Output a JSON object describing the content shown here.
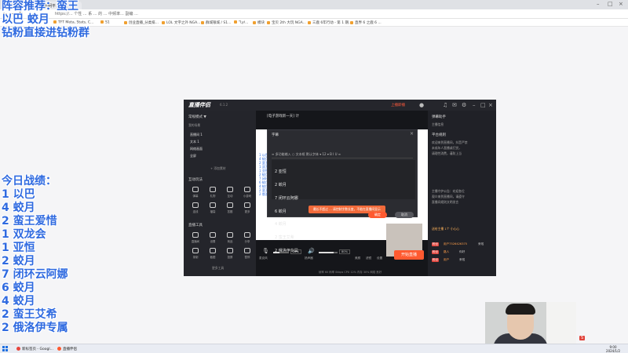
{
  "browser": {
    "tabs": [
      "中屏",
      "平明平 / 高位"
    ],
    "url": "https://... 个性 ... 系 ... 的 ... 中频率... 副编 ...",
    "bookmarks": [
      "TFT Meta, Stats, C...",
      "S1",
      "创业直播_分类排...",
      "LOL 文字之外 NGA...",
      "群城银城 / S1...",
      "\"Lyi...",
      "模块",
      "宝贝 2th 大玩 NGA...",
      "三鹿 6年行动 - 第 1 期...",
      "直界 6 之鹿 6 ..."
    ]
  },
  "overlay": {
    "recommend": "阵容推荐：蛮王",
    "line2": "以巴 蛟月",
    "line3": "钻粉直接进钻粉群",
    "record_title": "今日战绩：",
    "records": [
      "1 以巴",
      "4 蛟月",
      "2 蛮王爱惜",
      "1 双龙会",
      "1 亚恒",
      "2 蛟月",
      "7 闭环云阿娜",
      "6 蛟月",
      "4 蛟月",
      "2 蛮王艾希",
      "2 俄洛伊专属"
    ]
  },
  "app": {
    "logo": "直播伴侣",
    "version": "6.1.2",
    "status": "上播即播",
    "left": {
      "scene_header": "常规模式 ▼",
      "scene_sub_label": "我的场景",
      "scenes": [
        "直播间 1",
        "文本 1",
        "网络画面",
        "全屏"
      ],
      "add_source": "+ 添加素材",
      "interact_title": "互动玩法",
      "interact_items": [
        "弹幕",
        "礼物",
        "互动",
        "小游戏",
        "连线",
        "福袋",
        "答题",
        "更多"
      ],
      "tools_title": "直播工具",
      "tool_items": [
        "直播间",
        "设置",
        "商品",
        "分享",
        "录制",
        "截图",
        "投屏",
        "暂停"
      ],
      "more_tools": "更多工具"
    },
    "center": {
      "stream_title": "[电子游戏新一天] 计",
      "modal_title": "字幕",
      "modal_toolbar": "≡ 多功能输入   ○ 文本框   默认字体 ▾   12 ▾   B  I  U  ≡",
      "editor_lines": [
        "2 亚恒",
        "2 蛟月",
        "7 闭环云阿娜",
        "6 蛟月",
        "4 蛟月",
        "2 蛮王艾希",
        "2 俄洛伊专属"
      ],
      "preview_list": [
        "1 以巴",
        "4 蛟月",
        "2 蛮王爱惜",
        "1 双龙会",
        "1 亚恒",
        "2 蛟月",
        "7 闭环云阿娜",
        "6 蛟月",
        "4 蛟月",
        "2 蛮王艾希",
        "2 俄洛伊专属"
      ],
      "toast": "最长不超过 ... 请控制字数长度，不能在直播间显示",
      "confirm": "确定",
      "cancel": "取消",
      "mic_label": "麦克风",
      "mic_pct": "39%",
      "sound_label": "扬声器",
      "sound_pct": "80%",
      "beauty": "美颜",
      "filter": "滤镜",
      "settings": "设置",
      "start_button": "开始直播",
      "stats": "帧率 60  码率 0kbps  CPU 12%  内存 30%  网络 良好"
    },
    "right": {
      "header": "弹幕助手",
      "subheader": "主播信息",
      "rules_title": "平台规则",
      "rules_lines": [
        "欢迎来到直播间，抖音严禁",
        "未成年人直播或打赏，",
        "请理性消费，谨防上当"
      ],
      "notice_lines": [
        "主播守护公告：欢迎各位",
        "观众来到直播间，请遵守",
        "直播间规则文明发言"
      ],
      "chat": [
        {
          "tag": "粉丝",
          "name": "用户7526426375",
          "msg": "来啦"
        },
        {
          "tag": "粉丝",
          "name": "路人",
          "msg": "你好"
        },
        {
          "tag": "粉丝",
          "name": "用户",
          "msg": "来啦"
        }
      ],
      "gift_line": "送给主播 1个 小心心"
    }
  },
  "taskbar": {
    "items": [
      "新标签页 - Googl...",
      "直播伴侣"
    ],
    "time": "9:00",
    "date": "2024/1/2"
  },
  "colors": {
    "overlay_blue": "#2f6ae0",
    "accent_orange": "#ff5a30",
    "app_dark": "#1e1f24"
  }
}
